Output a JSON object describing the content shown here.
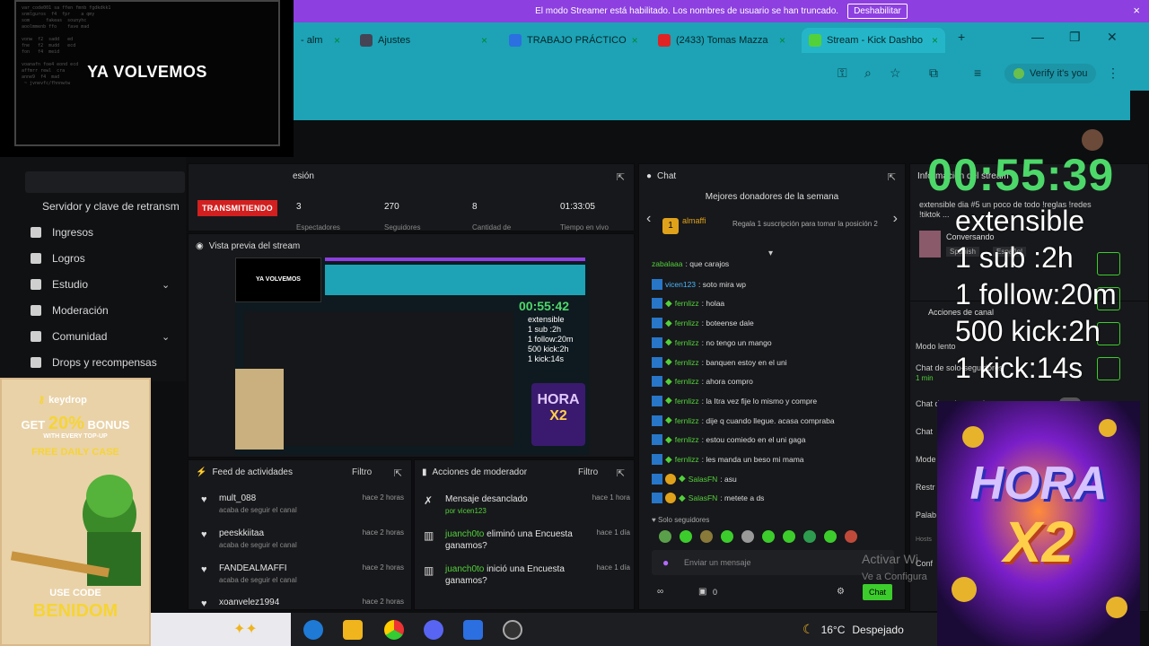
{
  "banner": {
    "text": "El modo Streamer está habilitado. Los nombres de usuario se han truncado.",
    "button": "Deshabilitar",
    "close": "×"
  },
  "tabs": [
    {
      "label": "- alm",
      "icon": "tab-icon"
    },
    {
      "label": "Ajustes",
      "icon": "settings-icon"
    },
    {
      "label": "TRABAJO PRÁCTICO",
      "icon": "docs-icon"
    },
    {
      "label": "(2433) Tomas Mazza",
      "icon": "youtube-icon"
    },
    {
      "label": "Stream - Kick Dashbo",
      "icon": "kick-icon"
    }
  ],
  "tab_close": "×",
  "new_tab": "+",
  "window": {
    "minimize": "—",
    "maximize": "❐",
    "close": "✕"
  },
  "verify": "Verify it's you",
  "overlay": {
    "title": "YA VOLVEMOS",
    "code": "var_code001 sa ffen fmnb fgdkdkk1\nsnmlguros  f4  fpr    a qmy\nsom      fakeas  sounyhc\naoolmmenb ffo    fave mad\n\nvonw  f2  sadd   ed\nfne   f2  mudd   ecd\nfon   f4  meid\n\nvoanafn foe4 eond ecd\naffmrr rewl  cra\nanne9  f4  mad\n ~ jvnevfc/fhnnwtw"
  },
  "sidebar": {
    "items": [
      {
        "label": "Servidor y clave de retransm",
        "icon": "none"
      },
      {
        "label": "Ingresos",
        "icon": "chart-icon"
      },
      {
        "label": "Logros",
        "icon": "trophy-icon"
      },
      {
        "label": "Estudio",
        "icon": "grid-icon",
        "chevron": "⌄"
      },
      {
        "label": "Moderación",
        "icon": "wrench-icon"
      },
      {
        "label": "Comunidad",
        "icon": "people-icon",
        "chevron": "⌄"
      },
      {
        "label": "Drops y recompensas",
        "icon": "gift-icon"
      }
    ]
  },
  "session": {
    "title": "esión",
    "live": "TRANSMITIENDO",
    "stats": [
      {
        "value": "3",
        "label": "Espectadores"
      },
      {
        "value": "270",
        "label": "Seguidores"
      },
      {
        "value": "8",
        "label": "Cantidad de"
      },
      {
        "value": "01:33:05",
        "label": "Tiempo en vivo"
      }
    ]
  },
  "preview": {
    "title": "Vista previa del stream",
    "inner_title": "YA VOLVEMOS",
    "timer": "00:55:42",
    "lines": [
      "extensible",
      "1 sub :2h",
      "1 follow:20m",
      "500 kick:2h",
      "1 kick:14s"
    ],
    "hora_line1": "HORA",
    "hora_line2": "X2"
  },
  "feed": {
    "title": "Feed de actividades",
    "filter": "Filtro",
    "rows": [
      {
        "name": "mult_088",
        "sub": "acaba de seguir el canal",
        "time": "hace 2 horas"
      },
      {
        "name": "peeskkiitaa",
        "sub": "acaba de seguir el canal",
        "time": "hace 2 horas"
      },
      {
        "name": "FANDEALMAFFI",
        "sub": "acaba de seguir el canal",
        "time": "hace 2 horas"
      },
      {
        "name": "xoanvelez1994",
        "sub": "",
        "time": "hace 2 horas"
      }
    ]
  },
  "mod": {
    "title": "Acciones de moderador",
    "filter": "Filtro",
    "rows": [
      {
        "user": "",
        "text": "Mensaje desanclado",
        "by": "por vicen123",
        "time": "hace 1 hora"
      },
      {
        "user": "juanch0to",
        "text": " eliminó una Encuesta ganamos?",
        "by": "",
        "time": "hace 1 día"
      },
      {
        "user": "juanch0to",
        "text": " inició una Encuesta ganamos?",
        "by": "",
        "time": "hace 1 día"
      }
    ]
  },
  "chat": {
    "title": "Chat",
    "donors_title": "Mejores donadores de la semana",
    "donor": "almaffi",
    "donor_rank": "1",
    "donor_cta": "Regala 1 suscripción para tomar la posición 2",
    "messages": [
      {
        "user": "zabalaaa",
        "text": ": que carajos",
        "badge": false,
        "dia": false,
        "coin": false
      },
      {
        "user": "vicen123",
        "text": ": soto mira wp",
        "badge": true,
        "dia": false,
        "coin": false,
        "blue": true
      },
      {
        "user": "fernlizz",
        "text": ": holaa",
        "badge": true,
        "dia": true,
        "coin": false
      },
      {
        "user": "fernlizz",
        "text": ": boteense dale",
        "badge": true,
        "dia": true,
        "coin": false
      },
      {
        "user": "fernlizz",
        "text": ": no tengo un mango",
        "badge": true,
        "dia": true,
        "coin": false
      },
      {
        "user": "fernlizz",
        "text": ": banquen estoy en el uni",
        "badge": true,
        "dia": true,
        "coin": false
      },
      {
        "user": "fernlizz",
        "text": ": ahora compro",
        "badge": true,
        "dia": true,
        "coin": false
      },
      {
        "user": "fernlizz",
        "text": ": la Itra vez fije lo mismo y compre",
        "badge": true,
        "dia": true,
        "coin": false
      },
      {
        "user": "fernlizz",
        "text": ": dije q cuando llegue. acasa compraba",
        "badge": true,
        "dia": true,
        "coin": false
      },
      {
        "user": "fernlizz",
        "text": ": estou comiedo en el uni gaga",
        "badge": true,
        "dia": true,
        "coin": false
      },
      {
        "user": "fernlizz",
        "text": ": les manda un beso mi mama",
        "badge": true,
        "dia": true,
        "coin": false
      },
      {
        "user": "SalasFN",
        "text": ": asu",
        "badge": true,
        "dia": true,
        "coin": true
      },
      {
        "user": "SalasFN",
        "text": ": metete a ds",
        "badge": true,
        "dia": true,
        "coin": true
      }
    ],
    "followers_only": "Solo seguidores",
    "input_placeholder": "Enviar un mensaje",
    "count": "0",
    "send": "Chat"
  },
  "rightpanel": {
    "title": "Información del stream",
    "stream_title": "extensible dia #5 un poco de todo !reglas !redes !tiktok ...",
    "category": "Conversando",
    "tags": [
      "Spanish",
      "Español"
    ],
    "mod_title": "Acciones de canal",
    "mod_rows": [
      "Modo lento",
      "Chat de solo-seguidores",
      "1 min",
      "Chat de solo-suscriptores",
      "Chat",
      "Mode",
      "Restr",
      "Palab",
      "Conf"
    ],
    "host": "Hosts"
  },
  "timer": "00:55:39",
  "goals": [
    "extensible",
    "1 sub :2h",
    "1 follow:20m",
    "500 kick:2h",
    "1 kick:14s"
  ],
  "ad": {
    "brand": "keydrop",
    "get": "GET",
    "percent": "20%",
    "bonus": "BONUS",
    "every": "WITH EVERY TOP-UP",
    "daily": "FREE DAILY CASE",
    "use": "USE CODE",
    "code": "BENIDOM"
  },
  "hora": {
    "line1": "HORA",
    "line2": "X2"
  },
  "taskbar": {
    "weather_temp": "16°C",
    "weather_desc": "Despejado"
  },
  "activate": {
    "line1": "Activar Wi",
    "line2": "Ve a Configura"
  },
  "colors": {
    "accent_green": "#53d13b",
    "banner": "#8d3fe0",
    "browser": "#1da3b5",
    "live": "#d21f1f",
    "timer": "#4dd86a"
  }
}
